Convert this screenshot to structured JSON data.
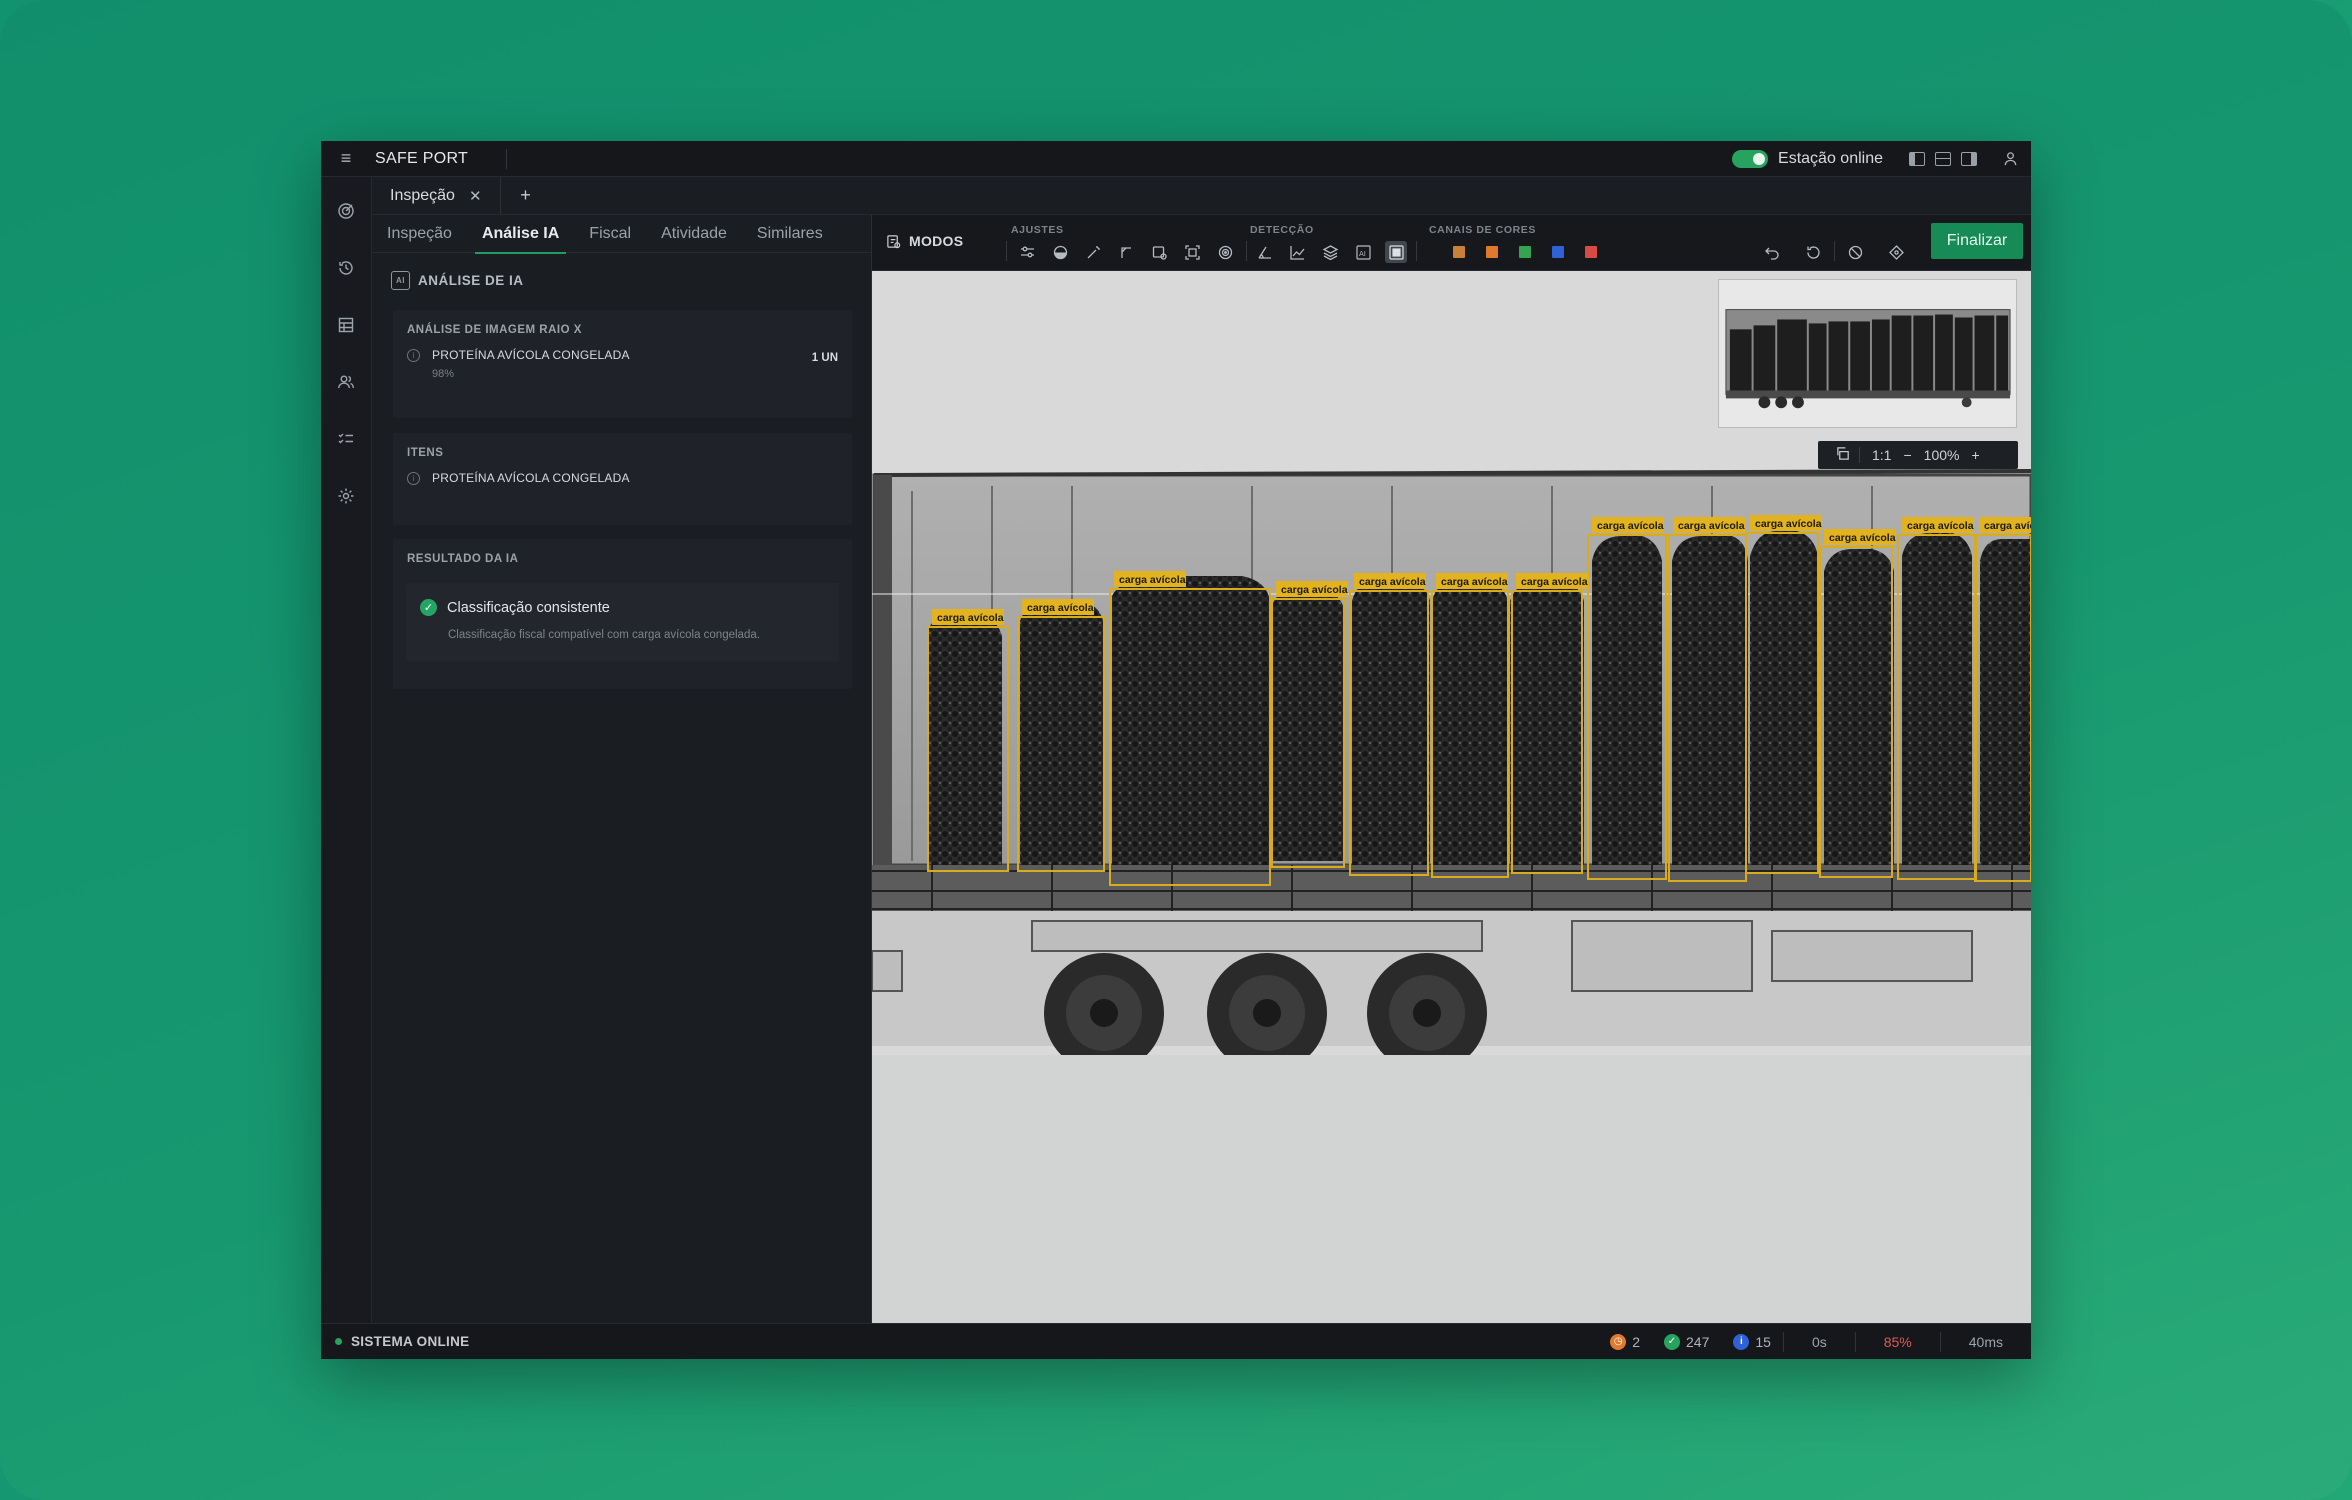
{
  "app": {
    "brand": "SAFE PORT",
    "station_status": "Estação online",
    "doc_tab": "Inspeção",
    "doc_tab_close": "✕",
    "add_tab": "+"
  },
  "panel": {
    "tabs": [
      {
        "label": "Inspeção",
        "active": false
      },
      {
        "label": "Análise IA",
        "active": true
      },
      {
        "label": "Fiscal",
        "active": false
      },
      {
        "label": "Atividade",
        "active": false
      },
      {
        "label": "Similares",
        "active": false
      }
    ],
    "title_badge": "AI",
    "title": "ANÁLISE DE IA",
    "xray_card": {
      "heading": "ANÁLISE DE IMAGEM RAIO X",
      "item": "PROTEÍNA AVÍCOLA CONGELADA",
      "confidence": "98%",
      "quantity": "1 UN"
    },
    "items_card": {
      "heading": "ITENS",
      "item": "PROTEÍNA AVÍCOLA CONGELADA"
    },
    "result_card": {
      "heading": "RESULTADO DA IA",
      "title": "Classificação consistente",
      "description": "Classificação fiscal compatível com carga avícola congelada."
    }
  },
  "toolbar": {
    "modes_label": "MODOS",
    "group_adjust": "AJUSTES",
    "group_detect": "DETECÇÃO",
    "group_channels": "CANAIS DE CORES",
    "channel_colors": [
      "#c9803a",
      "#e0782e",
      "#35a452",
      "#2f62d6",
      "#d84a46"
    ],
    "finish_label": "Finalizar"
  },
  "viewer": {
    "detection_label": "carga avícola",
    "zoom_ratio": "1:1",
    "zoom_minus": "−",
    "zoom_level": "100%",
    "zoom_plus": "+"
  },
  "status": {
    "system": "SISTEMA ONLINE",
    "pending_count": "2",
    "ok_count": "247",
    "info_count": "15",
    "time_metric": "0s",
    "load_metric": "85%",
    "latency_metric": "40ms"
  }
}
